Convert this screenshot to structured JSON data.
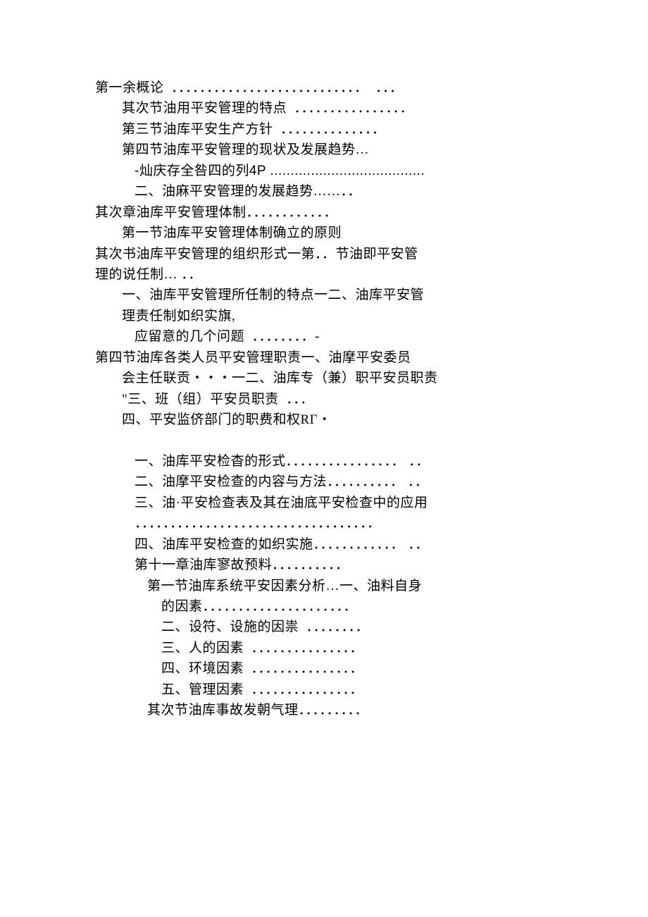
{
  "lines": [
    {
      "indent": 0,
      "text": "第一余概论  ．．．．．．．．．．．．．．．．．．．．．．．．．．．  ．．．"
    },
    {
      "indent": 1,
      "text": "其次节油用平安管理的特点  ．．．．．．．．．．．．．．．．"
    },
    {
      "indent": 1,
      "text": "第三节油库平安生产方针  ．．．．．．．．．．．．．．"
    },
    {
      "indent": 1,
      "text": "第四节油库平安管理的现状及发展趋势…"
    },
    {
      "indent": 2,
      "text": "-灿庆存全咎四的列4P ......................................",
      "bold": true
    },
    {
      "indent": 2,
      "text": "二、油麻平安管理的发展趋势……．．"
    },
    {
      "indent": 0,
      "text": "其次章油库平安管理体制．．．．．．．．．．．．"
    },
    {
      "indent": 1,
      "text": "第一节油库平安管理体制确立的原则"
    },
    {
      "indent": 0,
      "text": "其次书油库平安管理的组织形式一第．．节油即平安管"
    },
    {
      "indent": 0,
      "text": "理的说任制… ．．"
    },
    {
      "indent": 1,
      "text": "一、油库平安管理所任制的特点一二、油库平安管"
    },
    {
      "indent": 1,
      "text": "理责任制如织实旗,"
    },
    {
      "indent": 2,
      "text": "应留意的几个问题  ．．．．．．．．-"
    },
    {
      "indent": 0,
      "text": "第四节油库各类人员平安管理职责一、油摩平安委员"
    },
    {
      "indent": 1,
      "text": "会主任联贡・・・一二、油库专（兼）职平安员职责"
    },
    {
      "indent": 1,
      "text": "\"三、班（组）平安员职责  ．．．"
    },
    {
      "indent": 1,
      "text": "四、平安监侪部门的职费和权RГ・"
    },
    {
      "indent": 0,
      "text": " "
    },
    {
      "indent": 2,
      "text": "一、油库平安检杳的形式．．．．．．．．．．．．．．．． ．．"
    },
    {
      "indent": 2,
      "text": "二、油摩平安检查的内容与方法．．．．．．．．．． ．．"
    },
    {
      "indent": 2,
      "text": "三、油·平安检查表及其在油底平安检查中的应用"
    },
    {
      "indent": 2,
      "text": "．．．．．．．．．．．．．．．．．．．．．．．．．．．．．．．．．．"
    },
    {
      "indent": 2,
      "text": "四、油库平安检查的如织实施．．．．．．．．．．．． ．．"
    },
    {
      "indent": 2,
      "text": "第十一章油库寥故预料．．．．．．．．．．"
    },
    {
      "indent": 3,
      "text": "第一节油库系统平安因素分析…一、油料自身"
    },
    {
      "indent": 4,
      "text": "的因素．．．．．．．．．．．．．．．．．．．．．"
    },
    {
      "indent": 4,
      "text": "二、设符、设施的因祟  ．．．．．．．．"
    },
    {
      "indent": 4,
      "text": "三、人的因素  ．．．．．．．．．．．．．．．"
    },
    {
      "indent": 4,
      "text": "四、环境因素  ．．．．．．．．．．．．．．．"
    },
    {
      "indent": 4,
      "text": "五、管理因素  ．．．．．．．．．．．．．．．"
    },
    {
      "indent": 3,
      "text": "其次节油库事故发朝气理．．．．．．．．．"
    }
  ]
}
